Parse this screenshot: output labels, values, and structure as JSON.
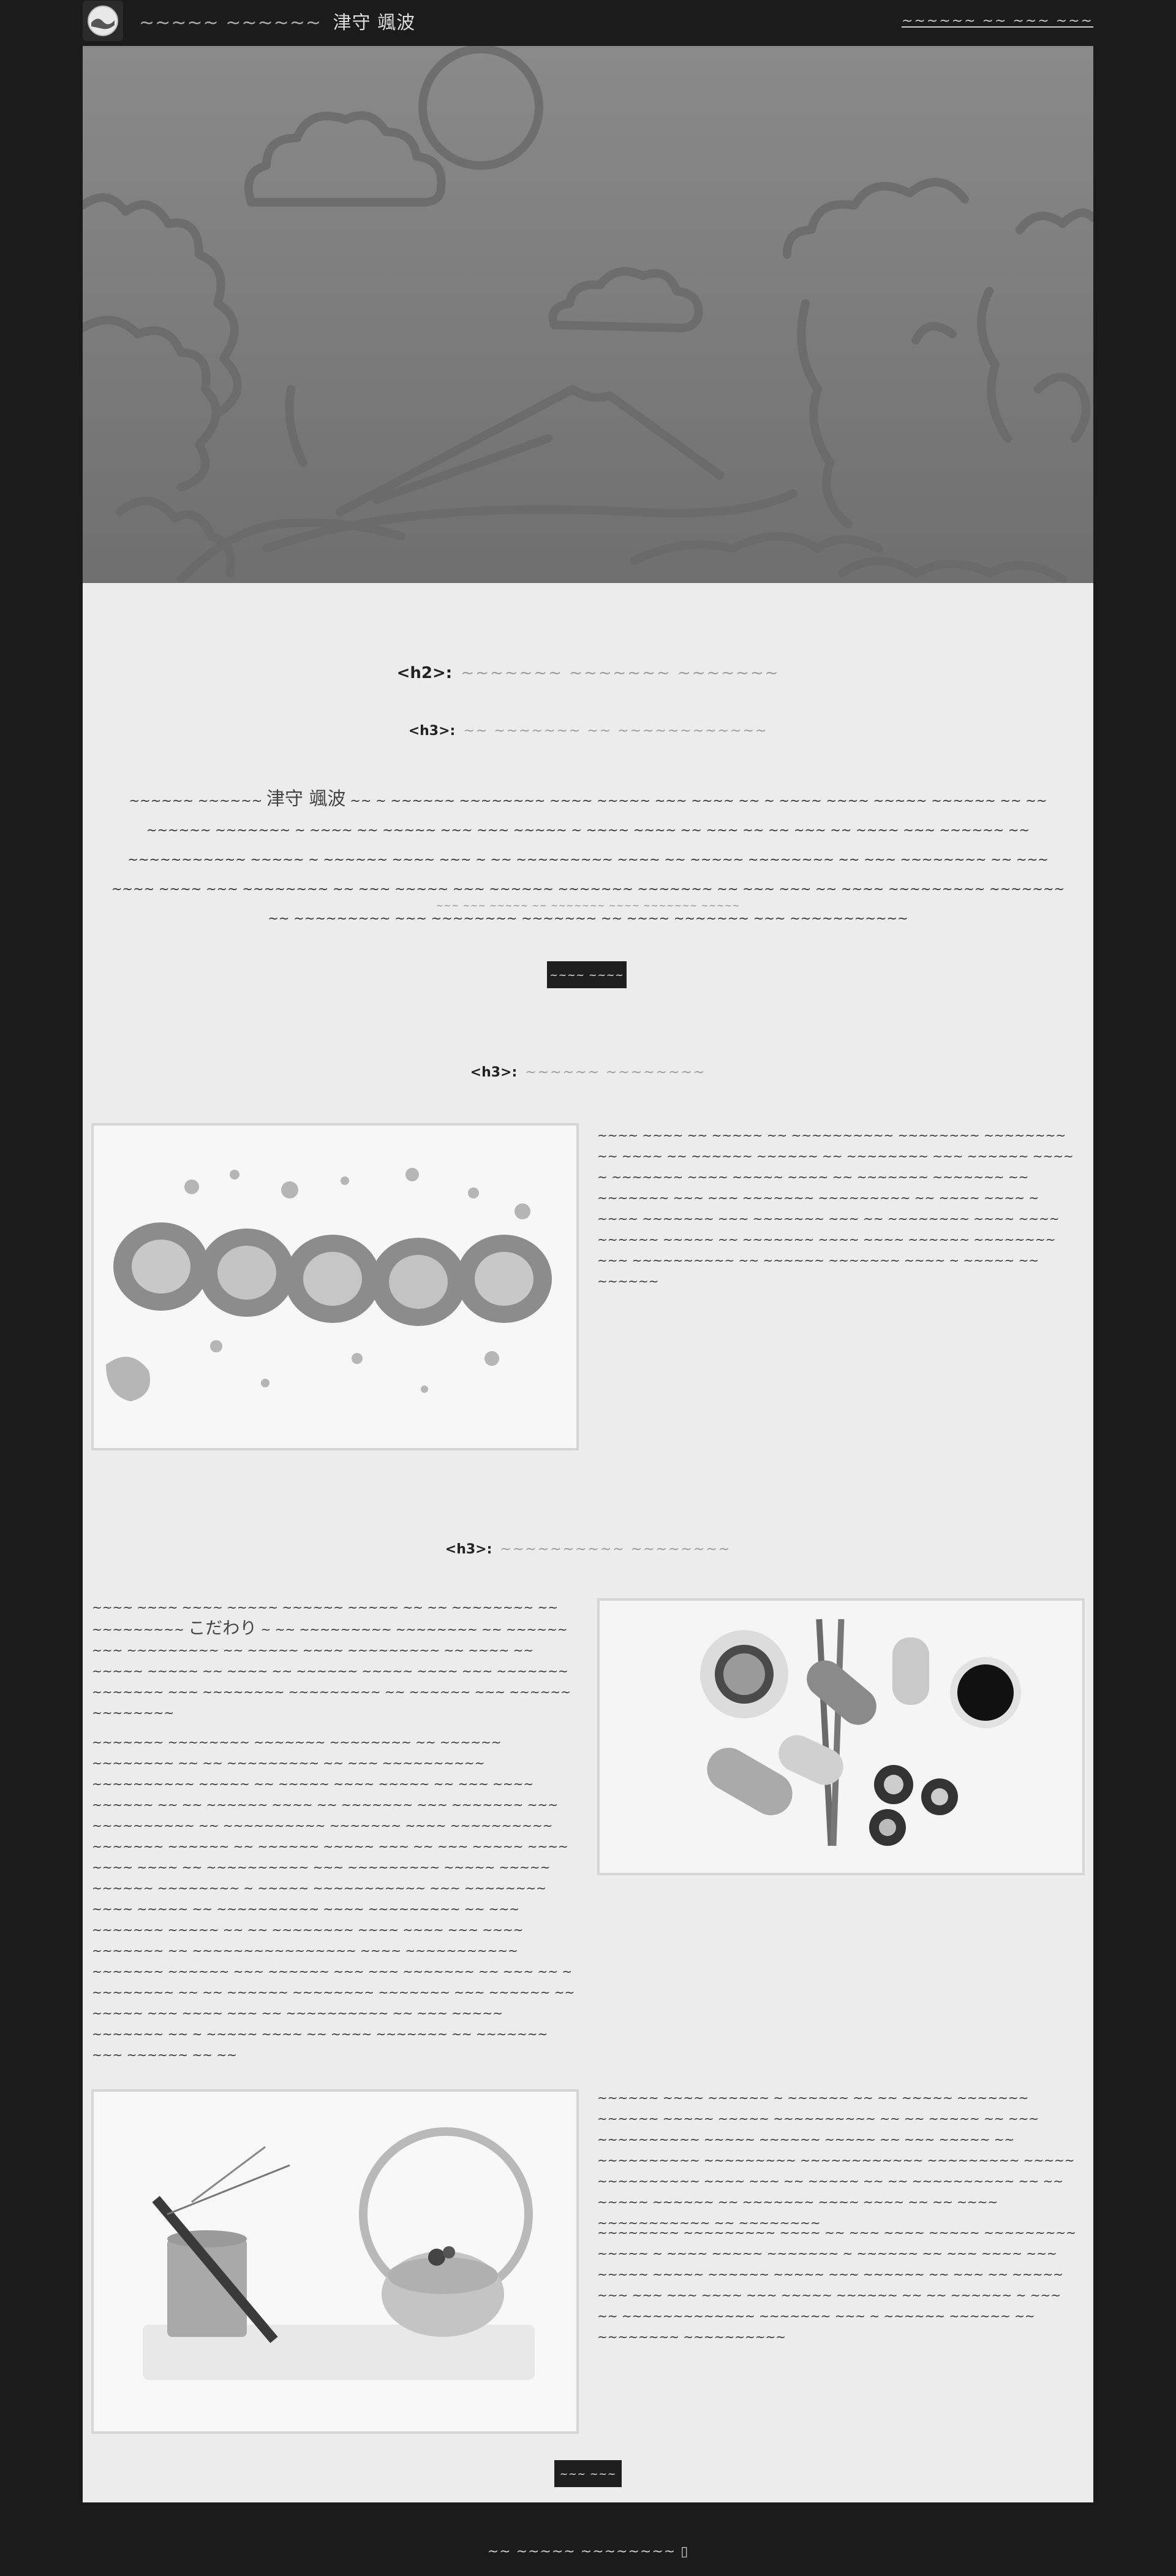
{
  "header": {
    "brand_prefix": "~~~~~ ~~~~~~",
    "brand_name": "津守 颯波",
    "link_label": "~~~~~~ ~~ ~~~ ~~~"
  },
  "intro": {
    "h2_tag": "<h2>:",
    "h2_text": "~~~~~~~ ~~~~~~~ ~~~~~~~",
    "h3_tag": "<h3>:",
    "h3_text": "~~ ~~~~~~~ ~~ ~~~~~~~~~~~~",
    "para_prefix": "~~~~~~ ~~~~~~ ",
    "para_name": "津守 颯波",
    "para_rest": " ~~ ~ ~~~~~~ ~~~~~~~~ ~~~~ ~~~~~ ~~~ ~~~~ ~~ ~ ~~~~ ~~~~ ~~~~~ ~~~~~~ ~~ ~~ ~~~~~~ ~~~~~~~ ~ ~~~~ ~~ ~~~~~ ~~~ ~~~ ~~~~~ ~ ~~~~ ~~~~ ~~ ~~~ ~~ ~~ ~~~ ~~ ~~~~ ~~~ ~~~~~~ ~~ ~~~~~~~~~~~ ~~~~~ ~ ~~~~~~ ~~~~ ~~~ ~ ~~ ~~~~~~~~~ ~~~~ ~~ ~~~~~ ~~~~~~~~ ~~ ~~~ ~~~~~~~~ ~~ ~~~ ~~~~ ~~~~ ~~~ ~~~~~~~~ ~~ ~~~ ~~~~~ ~~~ ~~~~~~ ~~~~~~~ ~~~~~~~ ~~ ~~~ ~~~ ~~ ~~~~ ~~~~~~~~~ ~~~~~~~ ~~ ~~~~~~~~~ ~~~ ~~~~~~~~ ~~~~~~~ ~~ ~~~~ ~~~~~~~ ~~~ ~~~~~~~~~~~",
    "small_note": "~~~ ~~~ ~~~~~ ~~ ~~~~~~~ ~~~~ ~~~~~~~ ~~~~~",
    "button_label": "~~~~ ~~~~"
  },
  "section1": {
    "h3_tag": "<h3>:",
    "h3_text": "~~~~~~ ~~~~~~~~",
    "para": "~~~~ ~~~~ ~~ ~~~~~ ~~ ~~~~~~~~~~ ~~~~~~~~ ~~~~~~~~ ~~ ~~~~ ~~ ~~~~~~ ~~~~~~ ~~ ~~~~~~~~ ~~~ ~~~~~~ ~~~~ ~ ~~~~~~~ ~~~~ ~~~~~ ~~~~ ~~ ~~~~~~~ ~~~~~~~ ~~ ~~~~~~~ ~~~ ~~~ ~~~~~~~ ~~~~~~~~~ ~~ ~~~~ ~~~~ ~ ~~~~ ~~~~~~~ ~~~ ~~~~~~~ ~~~ ~~ ~~~~~~~~ ~~~~ ~~~~ ~~~~~~ ~~~~~ ~~ ~~~~~~~ ~~~~ ~~~~ ~~~~~~ ~~~~~~~~ ~~~ ~~~~~~~~~~ ~~ ~~~~~~ ~~~~~~~ ~~~~ ~ ~~~~~ ~~ ~~~~~~"
  },
  "section2": {
    "h3_tag": "<h3>:",
    "h3_text": "~~~~~~~~~~ ~~~~~~~~",
    "para1_start": "~~~~ ~~~~ ~~~~ ~~~~~ ~~~~~~ ~~~~~ ~~ ~~ ~~~~~~~~ ~~ ~~~~~~~~~ ",
    "para1_em": "こだわり",
    "para1_rest": " ~ ~~ ~~~~~~~~~ ~~~~~~~~ ~~ ~~~~~~ ~~~ ~~~~~~~~~ ~~ ~~~~~ ~~~~ ~~~~~~~~~ ~~ ~~~~ ~~ ~~~~~ ~~~~~ ~~ ~~~~ ~~ ~~~~~~ ~~~~~ ~~~~ ~~~ ~~~~~~~ ~~~~~~~ ~~~ ~~~~~~~~ ~~~~~~~~~ ~~ ~~~~~~ ~~~ ~~~~~~ ~~~~~~~~",
    "para2": "~~~~~~~ ~~~~~~~~ ~~~~~~~ ~~~~~~~~ ~~ ~~~~~~ ~~~~~~~~ ~~ ~~ ~~~~~~~~~ ~~ ~~~ ~~~~~~~~~~ ~~~~~~~~~~ ~~~~~ ~~ ~~~~~ ~~~~ ~~~~~ ~~ ~~~ ~~~~ ~~~~~~ ~~ ~~ ~~~~~~ ~~~~ ~~ ~~~~~~~ ~~~ ~~~~~~~ ~~~ ~~~~~~~~~~ ~~ ~~~~~~~~~~ ~~~~~~~ ~~~~ ~~~~~~~~~~ ~~~~~~~ ~~~~~~ ~~ ~~~~~~ ~~~~~ ~~~ ~~ ~~~ ~~~~~ ~~~~ ~~~~ ~~~~ ~~ ~~~~~~~~~~ ~~~ ~~~~~~~~~ ~~~~~ ~~~~~ ~~~~~~ ~~~~~~~~ ~ ~~~~~ ~~~~~~~~~~~ ~~~ ~~~~~~~~ ~~~~ ~~~~~ ~~ ~~~~~~~~~~ ~~~~ ~~~~~~~~~ ~~ ~~~ ~~~~~~~ ~~~~~ ~~ ~~ ~~~~~~~~ ~~~~ ~~~~ ~~~ ~~~~ ~~~~~~~ ~~ ~~~~~~~~~~~~~~~~ ~~~~ ~~~~~~~~~~~ ~~~~~~~ ~~~~~~ ~~~ ~~~~~~ ~~~ ~~~ ~~~~~~~ ~~ ~~~ ~~ ~ ~~~~~~~~ ~~ ~~ ~~~~~~ ~~~~~~~~ ~~~~~~~ ~~~ ~~~~~~ ~~ ~~~~~ ~~~ ~~~~ ~~~ ~~ ~~~~~~~~~~ ~~ ~~~ ~~~~~ ~~~~~~~ ~~ ~ ~~~~~ ~~~~ ~~ ~~~~ ~~~~~~~ ~~ ~~~~~~~ ~~~ ~~~~~~ ~~ ~~"
  },
  "section3": {
    "para1": "~~~~~~ ~~~~ ~~~~~~ ~ ~~~~~~ ~~ ~~ ~~~~~ ~~~~~~~ ~~~~~~ ~~~~~ ~~~~~ ~~~~~~~~~~ ~~ ~~ ~~~~~ ~~ ~~~ ~~~~~~~~~~ ~~~~~ ~~~~~~ ~~~~~ ~~ ~~~ ~~~~~ ~~ ~~~~~~~~~~ ~~~~~~~~~ ~~~~~~~~~~~~ ~~~~~~~~~ ~~~~~ ~~~~~~~~~~ ~~~~ ~~~ ~~ ~~~~~ ~~ ~~ ~~~~~~~~~~ ~~ ~~ ~~~~~ ~~~~~~ ~~ ~~~~~~~ ~~~~ ~~~~ ~~ ~~ ~~~~ ~~~~~~~~~~~ ~~ ~~~~~~~~",
    "para2": "~~~~~~~~ ~~~~~~~~~ ~~~~ ~~ ~~~ ~~~~ ~~~~~ ~~~~~~~~~ ~~~~~ ~ ~~~~ ~~~~~ ~~~~~~~ ~ ~~~~~~ ~~ ~~~ ~~~~ ~~~ ~~~~~ ~~~~~ ~~~~~~ ~~~~~ ~~~ ~~~~~~ ~~ ~~~ ~~ ~~~~~ ~~~ ~~~ ~~~ ~~~~ ~~~ ~~~~~ ~~~~~~ ~~ ~~ ~~~~~~ ~ ~~~ ~~ ~~~~~~~~~~~~~ ~~~~~~~ ~~~ ~ ~~~~~~ ~~~~~~ ~~ ~~~~~~~~ ~~~~~~~~~~",
    "button_label": "~~~ ~~~"
  },
  "footer": {
    "text": "~~ ~~~~~ ~~~~~~~~ ",
    "icon_glyph": "▯"
  }
}
